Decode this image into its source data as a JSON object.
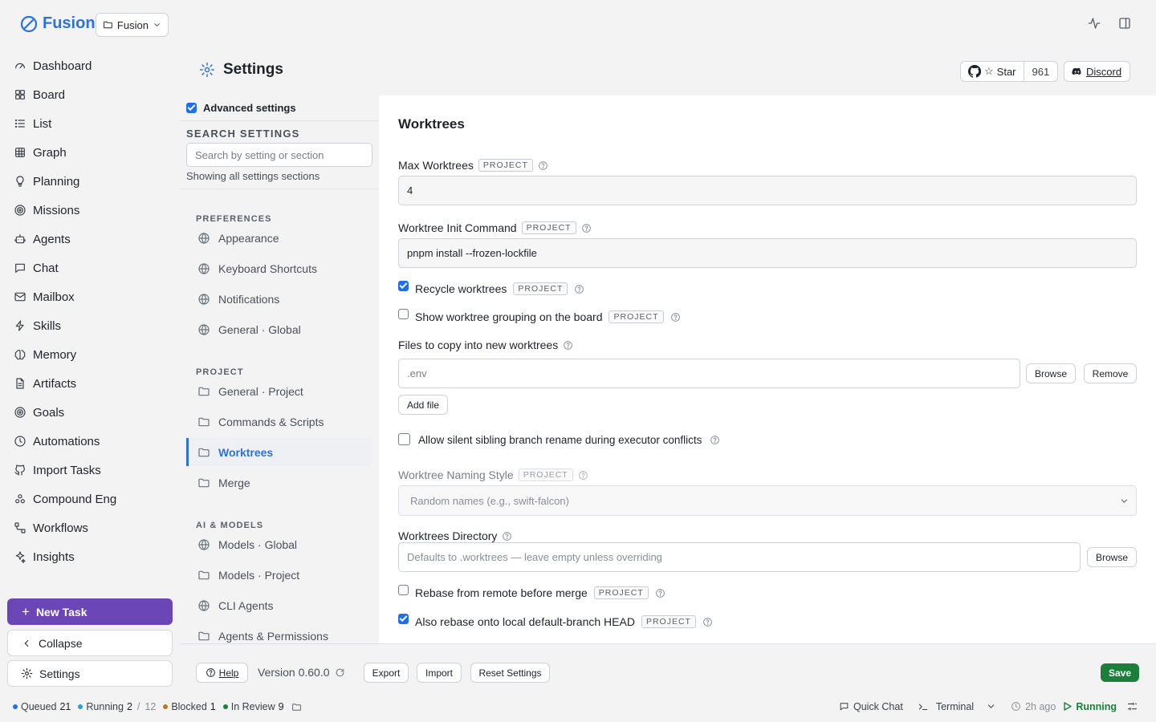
{
  "app": {
    "name": "Fusion",
    "project": "Fusion"
  },
  "nav": [
    {
      "label": "Dashboard",
      "icon": "dashboard-icon"
    },
    {
      "label": "Board",
      "icon": "board-icon"
    },
    {
      "label": "List",
      "icon": "list-icon"
    },
    {
      "label": "Graph",
      "icon": "graph-icon"
    },
    {
      "label": "Planning",
      "icon": "lightbulb-icon"
    },
    {
      "label": "Missions",
      "icon": "target-icon"
    },
    {
      "label": "Agents",
      "icon": "robot-icon"
    },
    {
      "label": "Chat",
      "icon": "chat-icon"
    },
    {
      "label": "Mailbox",
      "icon": "mail-icon"
    },
    {
      "label": "Skills",
      "icon": "bolt-icon"
    },
    {
      "label": "Memory",
      "icon": "brain-icon"
    },
    {
      "label": "Artifacts",
      "icon": "file-icon"
    },
    {
      "label": "Goals",
      "icon": "target-icon"
    },
    {
      "label": "Automations",
      "icon": "clock-icon"
    },
    {
      "label": "Import Tasks",
      "icon": "github-icon"
    },
    {
      "label": "Compound Eng",
      "icon": "cluster-icon"
    },
    {
      "label": "Workflows",
      "icon": "workflow-icon"
    },
    {
      "label": "Insights",
      "icon": "sparkle-icon"
    }
  ],
  "sidebar_actions": {
    "new_task": "New Task",
    "collapse": "Collapse",
    "settings": "Settings"
  },
  "header": {
    "title": "Settings",
    "github_star": "Star",
    "github_count": "961",
    "discord": "Discord"
  },
  "settings_nav": {
    "advanced_label": "Advanced settings",
    "advanced_checked": true,
    "search_heading": "SEARCH SETTINGS",
    "search_placeholder": "Search by setting or section",
    "search_status": "Showing all settings sections",
    "groups": [
      {
        "heading": "PREFERENCES",
        "items": [
          {
            "label": "Appearance",
            "icon": "globe-icon"
          },
          {
            "label": "Keyboard Shortcuts",
            "icon": "globe-icon"
          },
          {
            "label": "Notifications",
            "icon": "globe-icon"
          },
          {
            "label": "General · Global",
            "icon": "globe-icon"
          }
        ]
      },
      {
        "heading": "PROJECT",
        "items": [
          {
            "label": "General · Project",
            "icon": "folder-icon"
          },
          {
            "label": "Commands & Scripts",
            "icon": "folder-icon"
          },
          {
            "label": "Worktrees",
            "icon": "folder-icon",
            "active": true
          },
          {
            "label": "Merge",
            "icon": "folder-icon"
          }
        ]
      },
      {
        "heading": "AI & MODELS",
        "items": [
          {
            "label": "Models · Global",
            "icon": "globe-icon"
          },
          {
            "label": "Models · Project",
            "icon": "folder-icon"
          },
          {
            "label": "CLI Agents",
            "icon": "globe-icon"
          },
          {
            "label": "Agents & Permissions",
            "icon": "folder-icon"
          }
        ]
      }
    ]
  },
  "panel": {
    "title": "Worktrees",
    "project_tag": "PROJECT",
    "max_worktrees": {
      "label": "Max Worktrees",
      "value": "4"
    },
    "init_command": {
      "label": "Worktree Init Command",
      "value": "pnpm install --frozen-lockfile"
    },
    "recycle": {
      "label": "Recycle worktrees",
      "checked": true
    },
    "grouping": {
      "label": "Show worktree grouping on the board",
      "checked": false
    },
    "files_copy": {
      "label": "Files to copy into new worktrees",
      "value": ".env",
      "browse": "Browse",
      "remove": "Remove",
      "add_file": "Add file"
    },
    "silent_rename": {
      "label": "Allow silent sibling branch rename during executor conflicts",
      "checked": false
    },
    "naming_style": {
      "label": "Worktree Naming Style",
      "value": "Random names (e.g., swift-falcon)"
    },
    "directory": {
      "label": "Worktrees Directory",
      "placeholder": "Defaults to .worktrees — leave empty unless overriding",
      "browse": "Browse"
    },
    "rebase_remote": {
      "label": "Rebase from remote before merge",
      "checked": false
    },
    "rebase_local": {
      "label": "Also rebase onto local default-branch HEAD",
      "checked": true
    }
  },
  "footer": {
    "help": "Help",
    "version": "Version 0.60.0",
    "export": "Export",
    "import": "Import",
    "reset": "Reset Settings",
    "save": "Save"
  },
  "status": {
    "queued_label": "Queued",
    "queued": "21",
    "running_label": "Running",
    "running": "2",
    "running_sep": "/",
    "running_total": "12",
    "blocked_label": "Blocked",
    "blocked": "1",
    "review_label": "In Review",
    "review": "9",
    "quick_chat": "Quick Chat",
    "terminal": "Terminal",
    "last_update": "2h ago",
    "engine_state": "Running"
  },
  "colors": {
    "accent": "#2f72d6",
    "new_task": "#6b46b7",
    "save": "#1b7f3b",
    "queued": "#1f6feb",
    "running": "#2aa0d6",
    "blocked": "#b7791f",
    "review": "#1b7f3b",
    "engine": "#1b7f3b"
  }
}
